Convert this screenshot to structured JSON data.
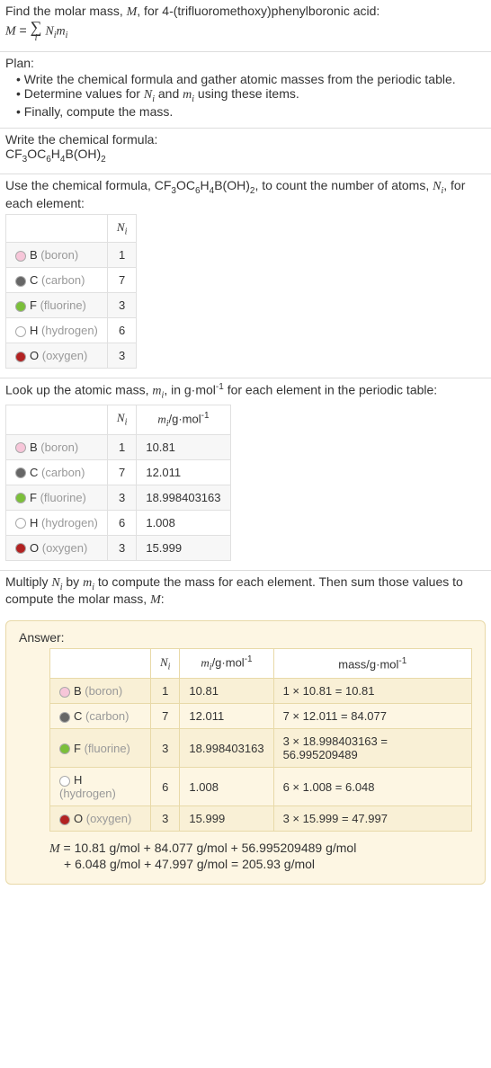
{
  "intro": {
    "line1a": "Find the molar mass, ",
    "line1b": ", for 4-(trifluoromethoxy)phenylboronic acid:",
    "M": "M",
    "eq_lhs": "M",
    "eq_eq": " = ",
    "Ni": "N",
    "mi": "m",
    "i": "i"
  },
  "plan": {
    "title": "Plan:",
    "item1a": "Write the chemical formula and gather atomic masses from the periodic table.",
    "item2a": "Determine values for ",
    "item2b": " and ",
    "item2c": " using these items.",
    "item3": "Finally, compute the mass."
  },
  "step1": {
    "title": "Write the chemical formula:",
    "formula_parts": [
      "CF",
      "3",
      "OC",
      "6",
      "H",
      "4",
      "B(OH)",
      "2"
    ]
  },
  "step2": {
    "text1": "Use the chemical formula, ",
    "text2": ", to count the number of atoms, ",
    "text3": ", for each element:",
    "header_Ni": "N",
    "rows": [
      {
        "color": "#f7c6d9",
        "sym": "B",
        "name": "(boron)",
        "n": "1"
      },
      {
        "color": "#666",
        "sym": "C",
        "name": "(carbon)",
        "n": "7"
      },
      {
        "color": "#7bbf3a",
        "sym": "F",
        "name": "(fluorine)",
        "n": "3"
      },
      {
        "color": "#fff",
        "sym": "H",
        "name": "(hydrogen)",
        "n": "6"
      },
      {
        "color": "#b22222",
        "sym": "O",
        "name": "(oxygen)",
        "n": "3"
      }
    ]
  },
  "step3": {
    "text1": "Look up the atomic mass, ",
    "text2": ", in g·mol",
    "text3": " for each element in the periodic table:",
    "neg1": "-1",
    "header_mi_a": "m",
    "header_mi_b": "/g·mol",
    "rows": [
      {
        "color": "#f7c6d9",
        "sym": "B",
        "name": "(boron)",
        "n": "1",
        "m": "10.81"
      },
      {
        "color": "#666",
        "sym": "C",
        "name": "(carbon)",
        "n": "7",
        "m": "12.011"
      },
      {
        "color": "#7bbf3a",
        "sym": "F",
        "name": "(fluorine)",
        "n": "3",
        "m": "18.998403163"
      },
      {
        "color": "#fff",
        "sym": "H",
        "name": "(hydrogen)",
        "n": "6",
        "m": "1.008"
      },
      {
        "color": "#b22222",
        "sym": "O",
        "name": "(oxygen)",
        "n": "3",
        "m": "15.999"
      }
    ]
  },
  "step4": {
    "text1": "Multiply ",
    "text2": " by ",
    "text3": " to compute the mass for each element. Then sum those values to compute the molar mass, ",
    "text4": ":"
  },
  "answer": {
    "title": "Answer:",
    "mass_header": "mass/g·mol",
    "rows": [
      {
        "color": "#f7c6d9",
        "sym": "B",
        "name": "(boron)",
        "n": "1",
        "m": "10.81",
        "calc": "1 × 10.81 = 10.81"
      },
      {
        "color": "#666",
        "sym": "C",
        "name": "(carbon)",
        "n": "7",
        "m": "12.011",
        "calc": "7 × 12.011 = 84.077"
      },
      {
        "color": "#7bbf3a",
        "sym": "F",
        "name": "(fluorine)",
        "n": "3",
        "m": "18.998403163",
        "calc": "3 × 18.998403163 = 56.995209489"
      },
      {
        "color": "#fff",
        "sym": "H",
        "name": "(hydrogen)",
        "n": "6",
        "m": "1.008",
        "calc": "6 × 1.008 = 6.048"
      },
      {
        "color": "#b22222",
        "sym": "O",
        "name": "(oxygen)",
        "n": "3",
        "m": "15.999",
        "calc": "3 × 15.999 = 47.997"
      }
    ],
    "final1": "M",
    "final2": " = 10.81 g/mol + 84.077 g/mol + 56.995209489 g/mol",
    "final3": "+ 6.048 g/mol + 47.997 g/mol = 205.93 g/mol"
  }
}
